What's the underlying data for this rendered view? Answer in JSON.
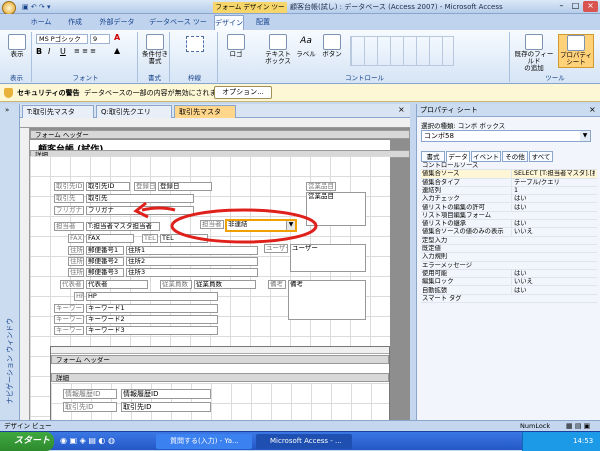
{
  "titlebar": {
    "contextual_tool": "フォーム デザイン ツール",
    "title": "顧客台帳(試し) : データベース (Access 2007) - Microsoft Access"
  },
  "ribbon_tabs": [
    "ホーム",
    "作成",
    "外部データ",
    "データベース ツール",
    "デザイン",
    "配置"
  ],
  "ribbon": {
    "font_name": "MS Pゴシック",
    "font_size": "9",
    "groups": [
      "表示",
      "フォント",
      "書式",
      "枠線",
      "コントロール",
      "ツール"
    ],
    "buttons": {
      "view": "表示",
      "conditional": "条件付き\n書式",
      "logo": "ロゴ",
      "textbox": "テキスト\nボックス",
      "label": "ラベル",
      "button": "ボタン",
      "add_field": "既存のフィールド\nの追加",
      "property_sheet": "プロパティ\nシート"
    }
  },
  "security": {
    "title": "セキュリティの警告",
    "message": "データベースの一部の内容が無効にされました",
    "options": "オプション..."
  },
  "nav_pane_label": "ナビゲーション ウィンドウ",
  "doc_tabs": [
    "T:取引先マスタ",
    "Q:取引先クエリ",
    "取引先マスタ"
  ],
  "form": {
    "form_header_band": "フォーム ヘッダー",
    "detail_band": "詳細",
    "title": "顧客台帳 (試作)",
    "fields": {
      "l_id": "取引先ID",
      "f_id": "取引先ID",
      "l_date": "登録日",
      "f_date": "登録日",
      "l_name": "取引先",
      "f_name": "取引先",
      "l_kana": "フリガナ",
      "f_kana": "フリガナ",
      "l_rep": "担当者",
      "f_rep": "T:担当者マスタ担当者",
      "l_rep2": "担当者",
      "f_rep2": "非連結",
      "l_fax": "FAX",
      "f_fax": "FAX",
      "l_tel": "TEL",
      "f_tel": "TEL",
      "l_addr1": "住所1",
      "f_zip1": "郵便番号1",
      "f_addr1": "住所1",
      "l_addr2": "住所2",
      "f_zip2": "郵便番号2",
      "f_addr2": "住所2",
      "l_addr3": "住所3",
      "f_zip3": "郵便番号3",
      "f_addr3": "住所3",
      "l_ceo": "代表者",
      "f_ceo": "代表者",
      "l_emp": "従業員数",
      "f_emp": "従業員数",
      "l_hp": "HP",
      "f_hp": "HP",
      "l_kw1": "キーワード1",
      "f_kw1": "キーワード1",
      "l_kw2": "キーワード2",
      "f_kw2": "キーワード2",
      "l_kw3": "キーワード3",
      "f_kw3": "キーワード3",
      "l_goods": "営業品目",
      "f_goods": "営業品目",
      "l_memo": "備考",
      "f_memo": "備考",
      "l_user": "ユーザー",
      "f_user": "ユーザー"
    },
    "subform": {
      "header_band": "フォーム ヘッダー",
      "detail_band": "詳細",
      "l_hist": "情報履歴ID",
      "f_hist": "情報履歴ID",
      "l_cid": "取引先ID",
      "f_cid": "取引先ID"
    }
  },
  "property_sheet": {
    "title": "プロパティ シート",
    "selection_type": "選択の種類: コンボ ボックス",
    "selected_object": "コンボ58",
    "tabs": [
      "書式",
      "データ",
      "イベント",
      "その他",
      "すべて"
    ],
    "rows": [
      {
        "name": "コントロールソース",
        "value": ""
      },
      {
        "name": "値集合ソース",
        "value": "SELECT [T:担当者マスタ].[担"
      },
      {
        "name": "値集合タイプ",
        "value": "テーブル/クエリ"
      },
      {
        "name": "連結列",
        "value": "1"
      },
      {
        "name": "入力チェック",
        "value": "はい"
      },
      {
        "name": "値リストの編集の許可",
        "value": "はい"
      },
      {
        "name": "リスト項目編集フォーム",
        "value": ""
      },
      {
        "name": "値リストの継承",
        "value": "はい"
      },
      {
        "name": "値集合ソースの値のみの表示",
        "value": "いいえ"
      },
      {
        "name": "定型入力",
        "value": ""
      },
      {
        "name": "既定値",
        "value": ""
      },
      {
        "name": "入力規則",
        "value": ""
      },
      {
        "name": "エラーメッセージ",
        "value": ""
      },
      {
        "name": "使用可能",
        "value": "はい"
      },
      {
        "name": "編集ロック",
        "value": "いいえ"
      },
      {
        "name": "自動拡張",
        "value": "はい"
      },
      {
        "name": "スマート タグ",
        "value": ""
      }
    ]
  },
  "status": {
    "left": "デザイン ビュー",
    "numlock": "NumLock"
  },
  "taskbar": {
    "start": "スタート",
    "task1": "質問する(入力) - Ya...",
    "task2": "Microsoft Access - ...",
    "clock": "14:53"
  },
  "colors": {
    "annotation": "#e0211b",
    "selected_ctrl": "#f0a000",
    "ribbon_accent": "#15428b"
  }
}
